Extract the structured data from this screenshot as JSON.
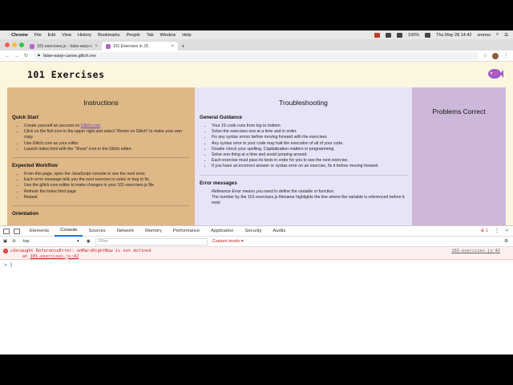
{
  "menubar": {
    "items": [
      "Chrome",
      "File",
      "Edit",
      "View",
      "History",
      "Bookmarks",
      "People",
      "Tab",
      "Window",
      "Help"
    ],
    "battery": "100%",
    "clock": "Thu May 28  14:42",
    "user": "xronos"
  },
  "browser": {
    "tabs": [
      {
        "title": "101-exercises.js – false-warp-c"
      },
      {
        "title": "101 Exercises in JS"
      }
    ],
    "url": "false-warp-canoe.glitch.me"
  },
  "page": {
    "title": "101 Exercises",
    "instructions": {
      "heading": "Instructions",
      "quick_start_heading": "Quick Start",
      "quick_start": [
        {
          "pre": "Create yourself an account on ",
          "link": "Glitch.com",
          "post": ""
        },
        {
          "pre": "Click on the fish icon in the upper right and select \"Remix on Glitch\" to make your own copy",
          "link": "",
          "post": ""
        },
        {
          "pre": "Use Glitch.com as your editor",
          "link": "",
          "post": ""
        },
        {
          "pre": "Launch index.html with the \"Show\" icon in the Glitch editor.",
          "link": "",
          "post": ""
        }
      ],
      "workflow_heading": "Expected Workflow",
      "workflow": [
        "From this page, open the JavaScript console to see the next error.",
        "Each error message tells you the next exercise to solve or bug to fix.",
        "Use the glitch.com editor to make changes in your 101-exercises.js file",
        "Refresh the index.html page",
        "Repeat"
      ],
      "orientation_heading": "Orientation"
    },
    "troubleshooting": {
      "heading": "Troubleshooting",
      "guidance_heading": "General Guidance",
      "guidance": [
        "Your JS code runs from top to bottom",
        "Solve the exercises one at a time and in order.",
        "Fix any syntax errors before moving forward with the exercises",
        "Any syntax error in your code may halt the execution of all of your code.",
        "Double check your spelling. Capitalization matters in programming.",
        "Solve one thing at a time and avoid jumping around.",
        "Each exercise must pass its tests in order for you to see the next exercise.",
        "If you have an incorrect answer or syntax error on an exercise, fix it before moving forward."
      ],
      "errors_heading": "Error messages",
      "ref_error_term": "Reference Error",
      "ref_error_text": " means you need to define the variable or function.",
      "filename_note": "The number by the 101-exercises.js filename highlights the line where the variable is referenced before it exist"
    },
    "problems": {
      "heading": "Problems Correct"
    }
  },
  "devtools": {
    "tabs": [
      "Elements",
      "Console",
      "Sources",
      "Network",
      "Memory",
      "Performance",
      "Application",
      "Security",
      "Audits"
    ],
    "active_tab": "Console",
    "error_count": "1",
    "context": "top",
    "filter_placeholder": "Filter",
    "levels": "Custom levels ▾",
    "error_message": "Uncaught ReferenceError: onMarsRightNow is not defined",
    "error_at_prefix": "at ",
    "error_at_link": "101-exercises.js:42",
    "error_source": "101-exercises.js:42",
    "prompt": ">"
  }
}
